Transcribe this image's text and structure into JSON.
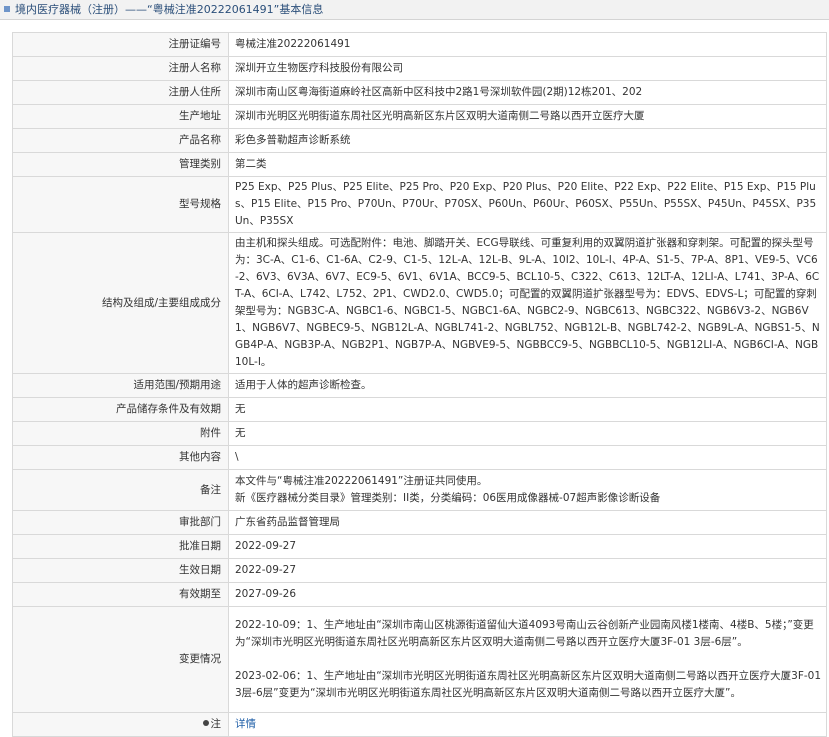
{
  "header": {
    "title": "境内医疗器械（注册）——“粤械注准20222061491”基本信息"
  },
  "rows": {
    "reg_no": {
      "label": "注册证编号",
      "value": "粤械注准20222061491"
    },
    "registrant": {
      "label": "注册人名称",
      "value": "深圳开立生物医疗科技股份有限公司"
    },
    "address": {
      "label": "注册人住所",
      "value": "深圳市南山区粤海街道麻岭社区高新中区科技中2路1号深圳软件园(2期)12栋201、202"
    },
    "production": {
      "label": "生产地址",
      "value": "深圳市光明区光明街道东周社区光明高新区东片区双明大道南侧二号路以西开立医疗大厦"
    },
    "product": {
      "label": "产品名称",
      "value": "彩色多普勒超声诊断系统"
    },
    "category": {
      "label": "管理类别",
      "value": "第二类"
    },
    "models": {
      "label": "型号规格",
      "value": "P25 Exp、P25 Plus、P25 Elite、P25 Pro、P20 Exp、P20 Plus、P20 Elite、P22 Exp、P22 Elite、P15 Exp、P15 Plus、P15 Elite、P15 Pro、P70Un、P70Ur、P70SX、P60Un、P60Ur、P60SX、P55Un、P55SX、P45Un、P45SX、P35Un、P35SX"
    },
    "structure": {
      "label": "结构及组成/主要组成成分",
      "value": "由主机和探头组成。可选配附件：电池、脚踏开关、ECG导联线、可重复利用的双翼阴道扩张器和穿刺架。可配置的探头型号为：3C-A、C1-6、C1-6A、C2-9、C1-5、12L-A、12L-B、9L-A、10I2、10L-I、4P-A、S1-5、7P-A、8P1、VE9-5、VC6-2、6V3、6V3A、6V7、EC9-5、6V1、6V1A、BCC9-5、BCL10-5、C322、C613、12LT-A、12LI-A、L741、3P-A、6CT-A、6CI-A、L742、L752、2P1、CWD2.0、CWD5.0；可配置的双翼阴道扩张器型号为：EDVS、EDVS-L；可配置的穿刺架型号为：NGB3C-A、NGBC1-6、NGBC1-5、NGBC1-6A、NGBC2-9、NGBC613、NGBC322、NGB6V3-2、NGB6V1、NGB6V7、NGBEC9-5、NGB12L-A、NGBL741-2、NGBL752、NGB12L-B、NGBL742-2、NGB9L-A、NGBS1-5、NGB4P-A、NGB3P-A、NGB2P1、NGB7P-A、NGBVE9-5、NGBBCC9-5、NGBBCL10-5、NGB12LI-A、NGB6CI-A、NGB10L-I。"
    },
    "scope": {
      "label": "适用范围/预期用途",
      "value": "适用于人体的超声诊断检查。"
    },
    "storage": {
      "label": "产品储存条件及有效期",
      "value": "无"
    },
    "attachment": {
      "label": "附件",
      "value": "无"
    },
    "other": {
      "label": "其他内容",
      "value": "\\"
    },
    "remark": {
      "label": "备注",
      "line1": "本文件与“粤械注准20222061491”注册证共同使用。",
      "line2": "新《医疗器械分类目录》管理类别：II类，分类编码：06医用成像器械-07超声影像诊断设备"
    },
    "authority": {
      "label": "审批部门",
      "value": "广东省药品监督管理局"
    },
    "approval_date": {
      "label": "批准日期",
      "value": "2022-09-27"
    },
    "effective_date": {
      "label": "生效日期",
      "value": "2022-09-27"
    },
    "expiry": {
      "label": "有效期至",
      "value": "2027-09-26"
    },
    "changes": {
      "label": "变更情况",
      "entry1": "2022-10-09：1、生产地址由“深圳市南山区桃源街道留仙大道4093号南山云谷创新产业园南风楼1楼南、4楼B、5楼；”变更为“深圳市光明区光明街道东周社区光明高新区东片区双明大道南侧二号路以西开立医疗大厦3F-01 3层-6层”。",
      "entry2": "2023-02-06：1、生产地址由“深圳市光明区光明街道东周社区光明高新区东片区双明大道南侧二号路以西开立医疗大厦3F-01 3层-6层”变更为“深圳市光明区光明街道东周社区光明高新区东片区双明大道南侧二号路以西开立医疗大厦”。"
    },
    "note": {
      "label": "注",
      "value": "详情",
      "icon": "note-icon"
    }
  }
}
